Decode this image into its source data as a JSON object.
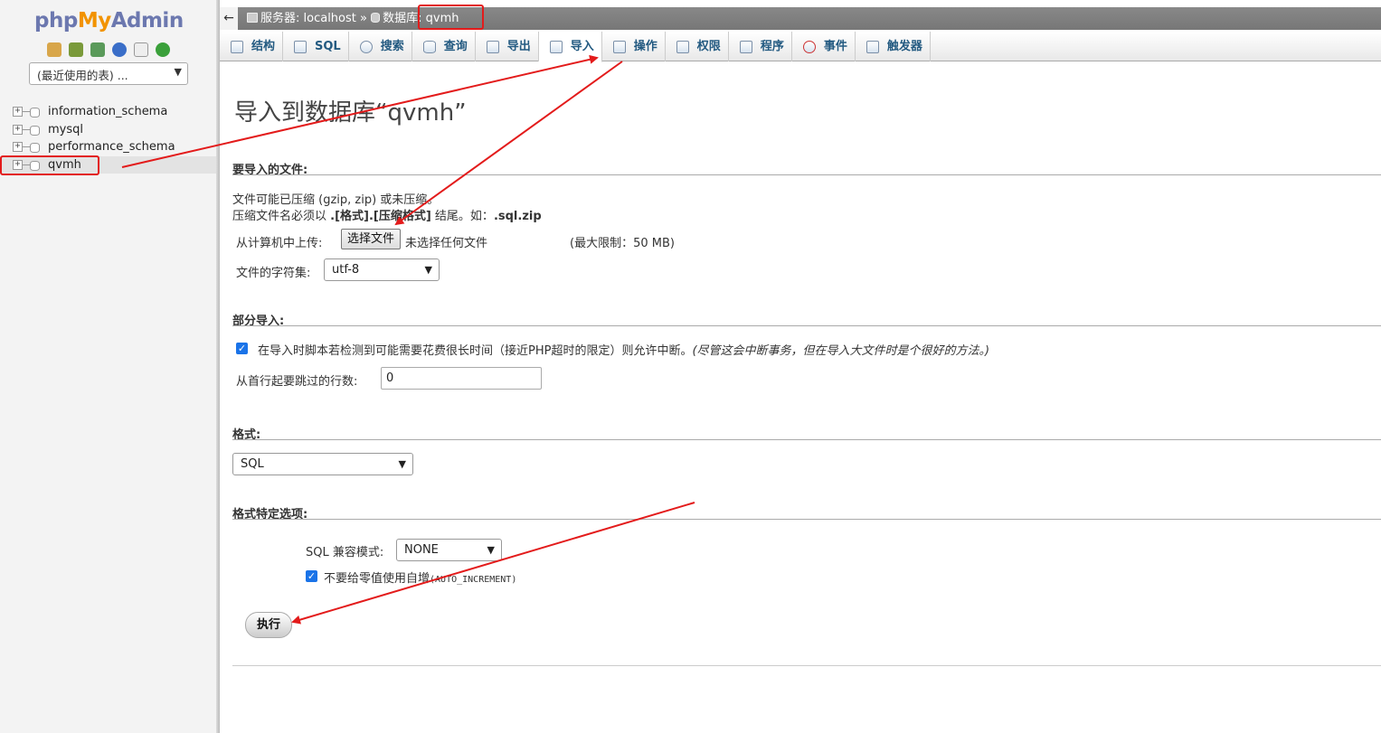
{
  "nav": {
    "logo_php": "php",
    "logo_my": "My",
    "logo_admin": "Admin",
    "icons": [
      "home-icon",
      "exit-icon",
      "query-window-icon",
      "help-icon",
      "docs-icon",
      "reload-icon"
    ],
    "recent_tables": "(最近使用的表) ...",
    "databases": [
      "information_schema",
      "mysql",
      "performance_schema",
      "qvmh"
    ],
    "active_database": "qvmh"
  },
  "breadcrumb": {
    "back": "←",
    "server_label": "服务器: localhost",
    "separator": "»",
    "database_label": "数据库: qvmh"
  },
  "tabs": [
    {
      "label": "结构",
      "icon": "structure-icon"
    },
    {
      "label": "SQL",
      "icon": "sql-icon"
    },
    {
      "label": "搜索",
      "icon": "search-icon"
    },
    {
      "label": "查询",
      "icon": "query-icon"
    },
    {
      "label": "导出",
      "icon": "export-icon"
    },
    {
      "label": "导入",
      "icon": "import-icon"
    },
    {
      "label": "操作",
      "icon": "wrench-icon"
    },
    {
      "label": "权限",
      "icon": "privileges-icon"
    },
    {
      "label": "程序",
      "icon": "routines-icon"
    },
    {
      "label": "事件",
      "icon": "events-icon"
    },
    {
      "label": "触发器",
      "icon": "triggers-icon"
    }
  ],
  "active_tab": "导入",
  "main": {
    "title": "导入到数据库“qvmh”",
    "file_section": {
      "heading": "要导入的文件:",
      "note1": "文件可能已压缩 (gzip, zip) 或未压缩。",
      "note2_prefix": "压缩文件名必须以 ",
      "note2_bold": ".[格式].[压缩格式]",
      "note2_mid": " 结尾。如：",
      "note2_example": ".sql.zip",
      "upload_label": "从计算机中上传:",
      "choose_file": "选择文件",
      "no_file": "未选择任何文件",
      "max_size": "(最大限制：50 MB)",
      "charset_label": "文件的字符集:",
      "charset_value": "utf-8"
    },
    "partial_section": {
      "heading": "部分导入:",
      "allow_interrupt": "在导入时脚本若检测到可能需要花费很长时间（接近PHP超时的限定）则允许中断。",
      "allow_interrupt_hint": "(尽管这会中断事务，但在导入大文件时是个很好的方法。)",
      "skip_label": "从首行起要跳过的行数:",
      "skip_value": "0"
    },
    "format_section": {
      "heading": "格式:",
      "value": "SQL"
    },
    "options_section": {
      "heading": "格式特定选项:",
      "compat_label": "SQL 兼容模式:",
      "compat_value": "NONE",
      "no_auto_value": "不要给零值使用自增",
      "no_auto_value_code": "(AUTO_INCREMENT)"
    },
    "go_button": "执行"
  },
  "colors": {
    "annotation": "#e31b1b",
    "tab_text": "#235a81",
    "checkbox": "#1a73e8"
  }
}
